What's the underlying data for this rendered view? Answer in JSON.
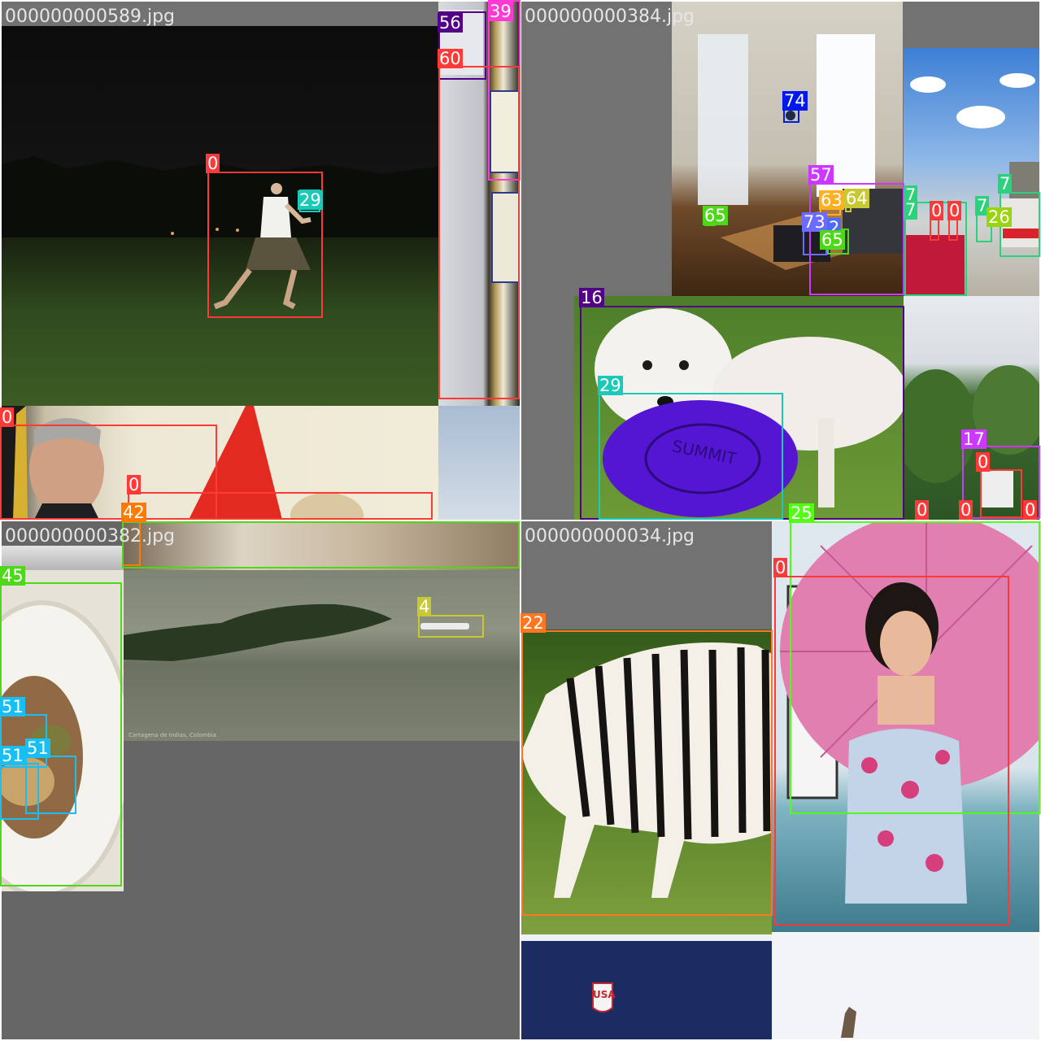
{
  "mosaic": {
    "tiles": [
      {
        "filename": "000000000589.jpg"
      },
      {
        "filename": "000000000384.jpg"
      },
      {
        "filename": "000000000382.jpg"
      },
      {
        "filename": "000000000034.jpg"
      }
    ]
  },
  "scene_texts": {
    "caption": "Cartagena de Indias, Colombia",
    "usa_logo": "USA",
    "frisbee_text": "SUMMIT"
  },
  "class_colors": {
    "0": "#ff3838",
    "4": "#c8c832",
    "7": "#2ad27b",
    "16": "#520085",
    "17": "#cb38ff",
    "22": "#ff7620",
    "25": "#52ff14",
    "26": "#9ad40d",
    "29": "#1bc9b8",
    "39": "#ff38d6",
    "42": "#ff7b00",
    "45": "#4fd71a",
    "51": "#18bff5",
    "56": "#520085",
    "57": "#cb38ff",
    "60": "#ff3838",
    "63": "#ffb020",
    "64": "#c8c832",
    "65": "#4fd71a",
    "73": "#6b6bff",
    "74": "#0018ec"
  },
  "detections": {
    "d1": "0",
    "d2": "29",
    "d3": "56",
    "d4": "39",
    "d5": "60",
    "d6": "74",
    "d7": "57",
    "d8": "63",
    "d9": "64",
    "d10": "65",
    "d11": "73",
    "d12": "2",
    "d13": "65",
    "d14": "7",
    "d15": "7",
    "d16": "0",
    "d17": "0",
    "d18": "7",
    "d19": "7",
    "d20": "26",
    "d21": "16",
    "d22": "29",
    "d23": "17",
    "d24": "0",
    "d25": "0",
    "d26": "0",
    "d27": "0",
    "d28": "0",
    "d29": "0",
    "d30": "42",
    "d31": "45",
    "d32": "51",
    "d33": "51",
    "d34": "51",
    "d35": "4",
    "d36": "22",
    "d37": "25",
    "d38": "0"
  }
}
